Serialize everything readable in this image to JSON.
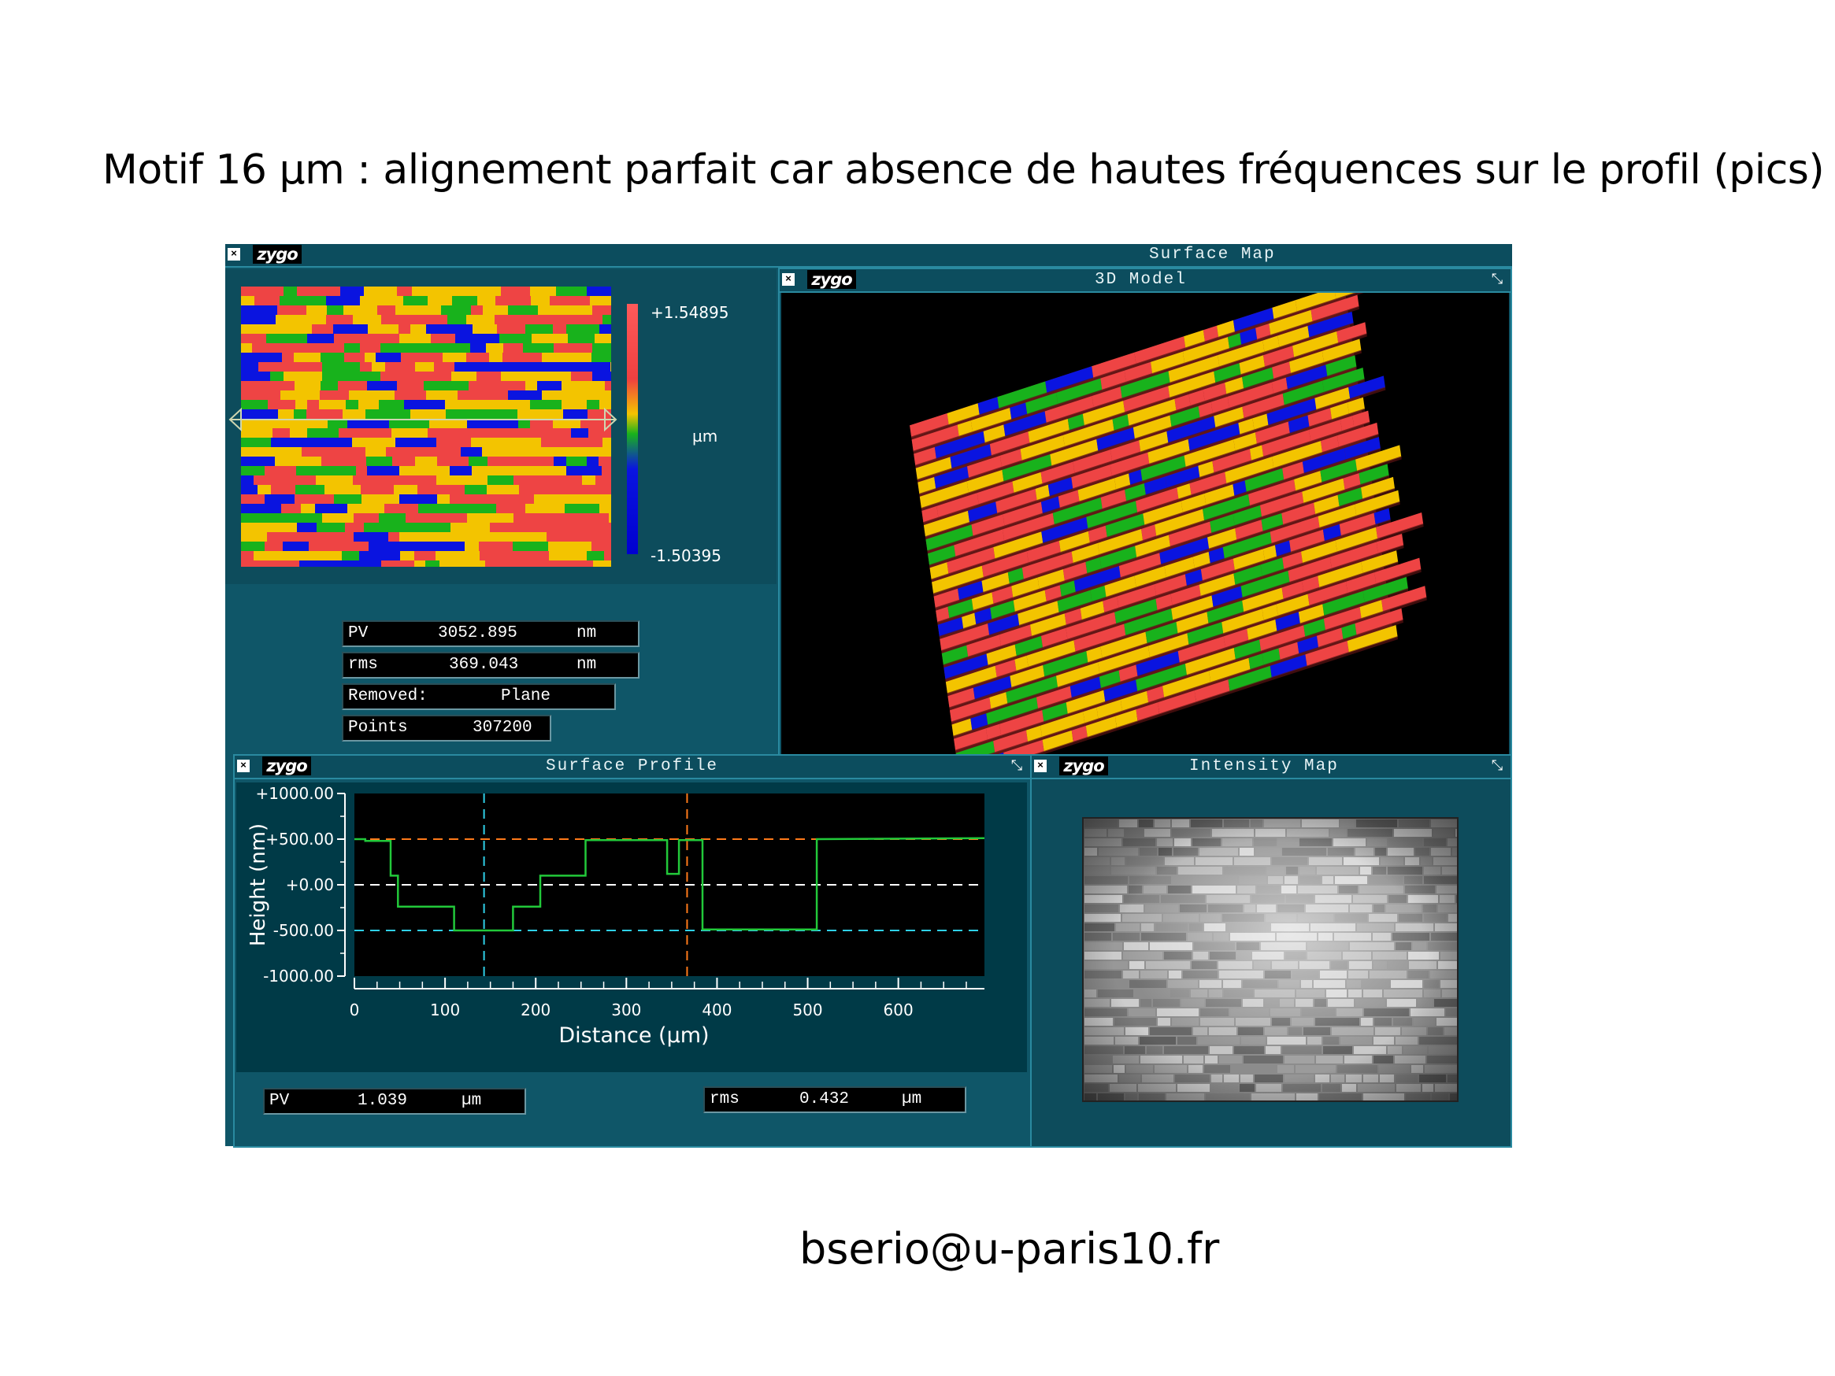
{
  "slide": {
    "title": "Motif 16 µm : alignement parfait car absence de hautes fréquences sur le profil (pics)",
    "footer_email": "bserio@u-paris10.fr"
  },
  "window": {
    "logo": "zygo",
    "title": "Surface Map"
  },
  "surface_map": {
    "colorbar_max": "+1.54895",
    "colorbar_unit": "µm",
    "colorbar_min": "-1.50395",
    "stats": [
      {
        "label": "PV",
        "value": "3052.895",
        "unit": "nm"
      },
      {
        "label": "rms",
        "value": "369.043",
        "unit": "nm"
      },
      {
        "label": "Removed:",
        "value": "Plane",
        "unit": ""
      },
      {
        "label": "Points",
        "value": "307200",
        "unit": ""
      }
    ]
  },
  "model_3d": {
    "logo": "zygo",
    "title": "3D Model"
  },
  "surface_profile": {
    "logo": "zygo",
    "title": "Surface Profile",
    "pv": {
      "label": "PV",
      "value": "1.039",
      "unit": "µm"
    },
    "rms": {
      "label": "rms",
      "value": "0.432",
      "unit": "µm"
    }
  },
  "intensity_map": {
    "logo": "zygo",
    "title": "Intensity Map"
  },
  "palette": {
    "red": "#ee4444",
    "yellow": "#f3c400",
    "green": "#18b21c",
    "blue": "#0a14e0",
    "window_bg": "#0f5668",
    "profile_line": "#22c93a",
    "cursor_orange": "#ff7a1a",
    "cursor_cyan": "#2fd0e8"
  },
  "chart_data": {
    "type": "line",
    "title": "",
    "xlabel": "Distance (µm)",
    "ylabel": "Height (nm)",
    "xlim": [
      0,
      695
    ],
    "ylim": [
      -1000,
      1000
    ],
    "x_ticks": [
      "0",
      "100",
      "200",
      "300",
      "400",
      "500",
      "600"
    ],
    "y_ticks": [
      "+1000.00",
      "+500.00",
      "+0.00",
      "-500.00",
      "-1000.00"
    ],
    "series": [
      {
        "name": "",
        "points": [
          [
            0,
            500
          ],
          [
            12,
            500
          ],
          [
            12,
            480
          ],
          [
            40,
            480
          ],
          [
            40,
            100
          ],
          [
            48,
            100
          ],
          [
            48,
            -240
          ],
          [
            110,
            -240
          ],
          [
            110,
            -500
          ],
          [
            175,
            -500
          ],
          [
            175,
            -240
          ],
          [
            205,
            -240
          ],
          [
            205,
            100
          ],
          [
            255,
            100
          ],
          [
            255,
            490
          ],
          [
            335,
            490
          ],
          [
            335,
            490
          ],
          [
            345,
            490
          ],
          [
            345,
            120
          ],
          [
            358,
            120
          ],
          [
            358,
            490
          ],
          [
            384,
            490
          ],
          [
            384,
            -490
          ],
          [
            510,
            -490
          ],
          [
            510,
            500
          ],
          [
            695,
            510
          ]
        ]
      }
    ],
    "reference_lines": [
      {
        "axis": "y",
        "value": 500,
        "style": "dashed",
        "color": "orange"
      },
      {
        "axis": "y",
        "value": 0,
        "style": "dashed",
        "color": "white"
      },
      {
        "axis": "y",
        "value": -500,
        "style": "dashed",
        "color": "cyan"
      },
      {
        "axis": "x",
        "value": 143,
        "style": "dashed",
        "color": "cyan"
      },
      {
        "axis": "x",
        "value": 367,
        "style": "dashed",
        "color": "orange"
      }
    ],
    "grid": false
  }
}
